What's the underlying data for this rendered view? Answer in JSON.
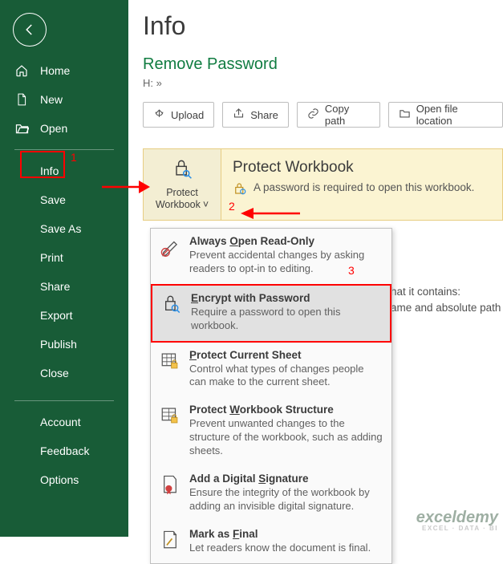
{
  "sidebar": {
    "home": "Home",
    "new": "New",
    "open": "Open",
    "info": "Info",
    "save": "Save",
    "save_as": "Save As",
    "print": "Print",
    "share": "Share",
    "export": "Export",
    "publish": "Publish",
    "close": "Close",
    "account": "Account",
    "feedback": "Feedback",
    "options": "Options"
  },
  "main": {
    "title": "Info",
    "doc_title": "Remove Password",
    "doc_path": "H: »",
    "actions": {
      "upload": "Upload",
      "share": "Share",
      "copy_path": "Copy path",
      "open_location": "Open file location"
    },
    "protect": {
      "btn_line1": "Protect",
      "btn_line2": "Workbook",
      "heading": "Protect Workbook",
      "desc": "A password is required to open this workbook."
    },
    "sidetext": {
      "line1": "hat it contains:",
      "line2": "ame and absolute path"
    }
  },
  "menu": {
    "items": [
      {
        "title_pre": "Always ",
        "title_u": "O",
        "title_post": "pen Read-Only",
        "desc": "Prevent accidental changes by asking readers to opt-in to editing."
      },
      {
        "title_pre": "",
        "title_u": "E",
        "title_post": "ncrypt with Password",
        "desc": "Require a password to open this workbook."
      },
      {
        "title_pre": "",
        "title_u": "P",
        "title_post": "rotect Current Sheet",
        "desc": "Control what types of changes people can make to the current sheet."
      },
      {
        "title_pre": "Protect ",
        "title_u": "W",
        "title_post": "orkbook Structure",
        "desc": "Prevent unwanted changes to the structure of the workbook, such as adding sheets."
      },
      {
        "title_pre": "Add a Digital ",
        "title_u": "S",
        "title_post": "ignature",
        "desc": "Ensure the integrity of the workbook by adding an invisible digital signature."
      },
      {
        "title_pre": "Mark as ",
        "title_u": "F",
        "title_post": "inal",
        "desc": "Let readers know the document is final."
      }
    ]
  },
  "annotations": {
    "n1": "1",
    "n2": "2",
    "n3": "3"
  },
  "watermark": {
    "name": "exceldemy",
    "tag": "EXCEL · DATA · BI"
  }
}
